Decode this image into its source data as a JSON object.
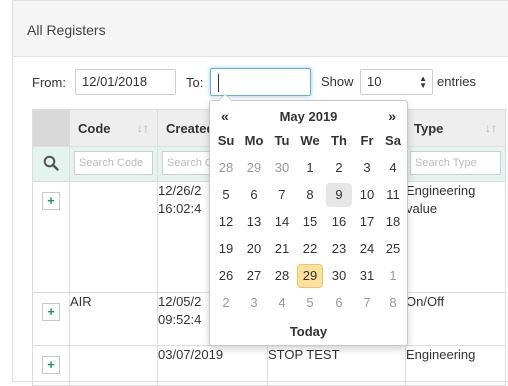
{
  "panel": {
    "title": "All Registers"
  },
  "filters": {
    "from_label": "From:",
    "from_value": "12/01/2018",
    "to_label": "To:",
    "to_value": "",
    "show_label": "Show",
    "show_value": "10",
    "entries_label": "entries"
  },
  "table": {
    "columns": [
      "Code",
      "Created",
      "",
      "Type"
    ],
    "filter_placeholders": {
      "code": "Search Code",
      "created": "Search C",
      "type": "Search Type"
    },
    "rows": [
      {
        "code": "",
        "created_line1": "12/26/2",
        "created_line2": "16:02:4",
        "name": "",
        "type_line1": "Engineering",
        "type_line2": "value"
      },
      {
        "code": "AIR",
        "created_line1": "12/05/2",
        "created_line2": "09:52:4",
        "name": "",
        "type_line1": "On/Off",
        "type_line2": ""
      },
      {
        "code": "",
        "created_line1": "03/07/2019",
        "created_line2": "",
        "name": "STOP TEST",
        "type_line1": "Engineering",
        "type_line2": ""
      }
    ]
  },
  "datepicker": {
    "prev": "«",
    "next": "»",
    "title": "May 2019",
    "days_of_week": [
      "Su",
      "Mo",
      "Tu",
      "We",
      "Th",
      "Fr",
      "Sa"
    ],
    "weeks": [
      [
        "28",
        "29",
        "30",
        "1",
        "2",
        "3",
        "4"
      ],
      [
        "5",
        "6",
        "7",
        "8",
        "9",
        "10",
        "11"
      ],
      [
        "12",
        "13",
        "14",
        "15",
        "16",
        "17",
        "18"
      ],
      [
        "19",
        "20",
        "21",
        "22",
        "23",
        "24",
        "25"
      ],
      [
        "26",
        "27",
        "28",
        "29",
        "30",
        "31",
        "1"
      ],
      [
        "2",
        "3",
        "4",
        "5",
        "6",
        "7",
        "8"
      ]
    ],
    "highlighted": "9",
    "today": "29",
    "today_label": "Today"
  },
  "colors": {
    "accent": "#1a9a6c",
    "today_bg": "#fde19a",
    "focus": "#66afe9",
    "filter_row": "#e3f3ee"
  }
}
